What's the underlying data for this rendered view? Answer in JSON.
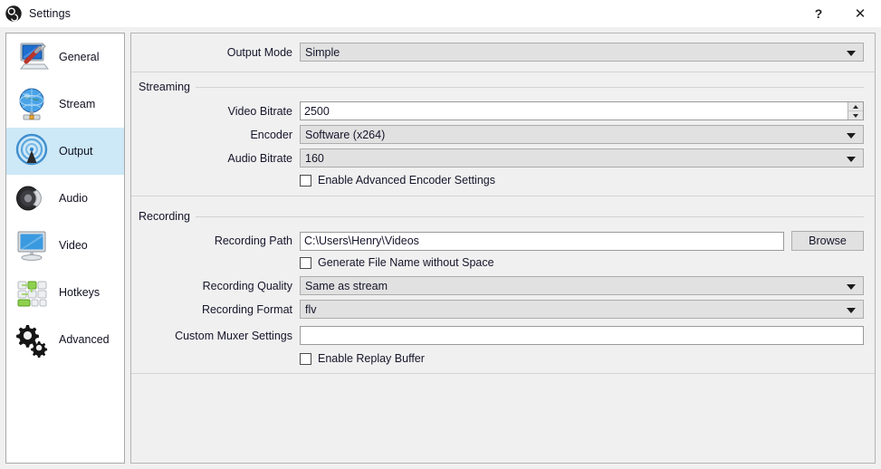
{
  "window": {
    "title": "Settings",
    "app_icon": "obs-logo-icon",
    "controls": {
      "help": "?",
      "close": "✕"
    }
  },
  "sidebar": {
    "items": [
      {
        "label": "General",
        "icon": "monitor-screwdriver-icon",
        "selected": false
      },
      {
        "label": "Stream",
        "icon": "globe-broadcast-icon",
        "selected": false
      },
      {
        "label": "Output",
        "icon": "signal-antenna-icon",
        "selected": true
      },
      {
        "label": "Audio",
        "icon": "speaker-icon",
        "selected": false
      },
      {
        "label": "Video",
        "icon": "monitor-icon",
        "selected": false
      },
      {
        "label": "Hotkeys",
        "icon": "keyboard-keys-icon",
        "selected": false
      },
      {
        "label": "Advanced",
        "icon": "gears-icon",
        "selected": false
      }
    ]
  },
  "output": {
    "output_mode": {
      "label": "Output Mode",
      "value": "Simple"
    },
    "streaming": {
      "title": "Streaming",
      "video_bitrate": {
        "label": "Video Bitrate",
        "value": "2500"
      },
      "encoder": {
        "label": "Encoder",
        "value": "Software (x264)"
      },
      "audio_bitrate": {
        "label": "Audio Bitrate",
        "value": "160"
      },
      "advanced_encoder": {
        "label": "Enable Advanced Encoder Settings",
        "checked": false
      }
    },
    "recording": {
      "title": "Recording",
      "recording_path": {
        "label": "Recording Path",
        "value": "C:\\Users\\Henry\\Videos"
      },
      "browse_button": "Browse",
      "generate_filename": {
        "label": "Generate File Name without Space",
        "checked": false
      },
      "recording_quality": {
        "label": "Recording Quality",
        "value": "Same as stream"
      },
      "recording_format": {
        "label": "Recording Format",
        "value": "flv"
      },
      "custom_muxer": {
        "label": "Custom Muxer Settings",
        "value": "",
        "placeholder": ""
      },
      "replay_buffer": {
        "label": "Enable Replay Buffer",
        "checked": false
      }
    }
  },
  "colors": {
    "selection": "#cde8f7",
    "window_bg": "#f0f0f0",
    "combo_bg": "#e1e1e1",
    "field_bg": "#ffffff"
  }
}
